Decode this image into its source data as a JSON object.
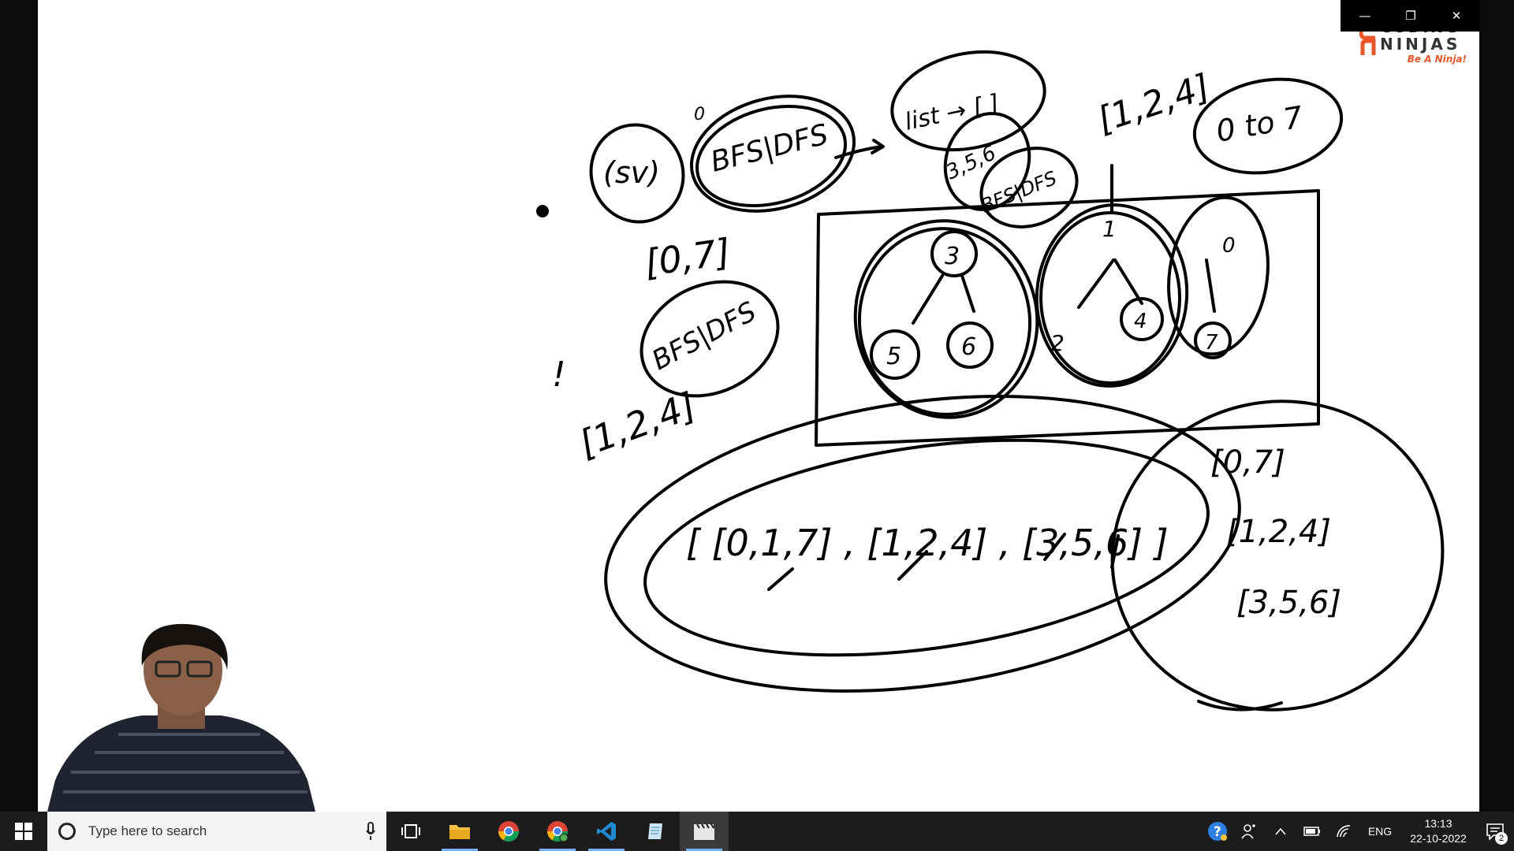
{
  "window": {
    "minimize_glyph": "—",
    "restore_glyph": "❐",
    "close_glyph": "✕"
  },
  "logo": {
    "brand_top": "CODING",
    "brand": "NINJAS",
    "tagline": "Be A Ninja!",
    "accent_color": "#e8562a"
  },
  "whiteboard": {
    "notes": {
      "sv": "(sv)",
      "zero_top": "0",
      "bfs_dfs_1": "BFS|DFS",
      "list": "list → [ ]",
      "list_item": "3,5,6",
      "bfs_dfs_2": "BFS|DFS",
      "range_top": "[1,2,4]",
      "zero_to_seven": "0 to 7",
      "range_left": "[0,7]",
      "bfs_dfs_3": "BFS|DFS",
      "range_left2": "[1,2,4]",
      "exclaim": "!",
      "node_3": "3",
      "node_5": "5",
      "node_6": "6",
      "node_4": "4",
      "node_2": "2",
      "node_0": "0",
      "node_7": "7",
      "node_1": "1",
      "nested_list": "[ [0,1,7] , [1,2,4] , [3,5,6] ]",
      "side_list_1": "[0,7]",
      "side_list_2": "[1,2,4]",
      "side_list_3": "[3,5,6]"
    }
  },
  "taskbar": {
    "search_placeholder": "Type here to search",
    "apps": [
      "file-explorer",
      "chrome",
      "chrome-profile",
      "vscode",
      "notepad",
      "video-editor"
    ],
    "tray": {
      "language": "ENG",
      "time": "13:13",
      "date": "22-10-2022",
      "notification_count": "2"
    }
  }
}
